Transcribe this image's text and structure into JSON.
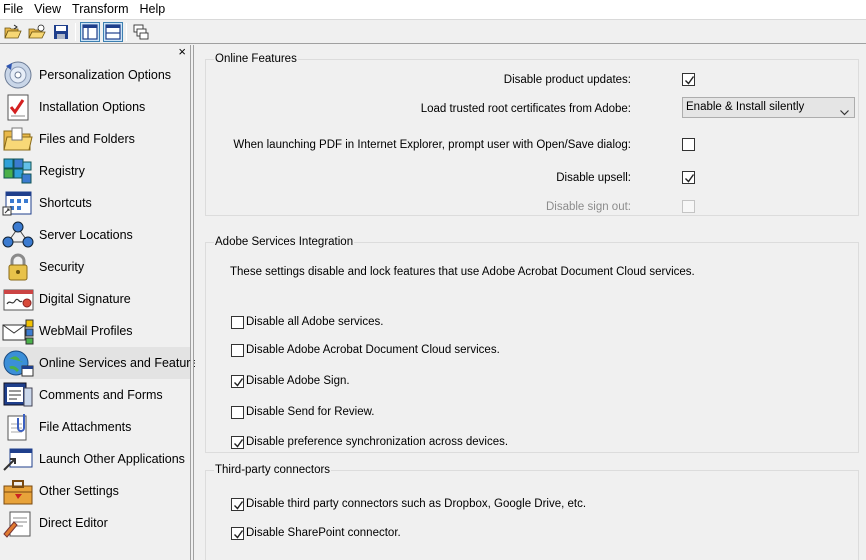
{
  "menu": [
    "File",
    "View",
    "Transform",
    "Help"
  ],
  "sidebar": {
    "close_glyph": "×",
    "items": [
      {
        "label": "Personalization Options",
        "icon": "cd-disc-icon"
      },
      {
        "label": "Installation Options",
        "icon": "checklist-icon"
      },
      {
        "label": "Files and Folders",
        "icon": "folder-icon"
      },
      {
        "label": "Registry",
        "icon": "registry-cubes-icon"
      },
      {
        "label": "Shortcuts",
        "icon": "shortcut-grid-icon"
      },
      {
        "label": "Server Locations",
        "icon": "network-icon"
      },
      {
        "label": "Security",
        "icon": "padlock-icon"
      },
      {
        "label": "Digital Signature",
        "icon": "signature-certificate-icon"
      },
      {
        "label": "WebMail Profiles",
        "icon": "envelope-icon"
      },
      {
        "label": "Online Services and Features",
        "icon": "globe-icon"
      },
      {
        "label": "Comments and Forms",
        "icon": "forms-icon"
      },
      {
        "label": "File Attachments",
        "icon": "paperclip-document-icon"
      },
      {
        "label": "Launch Other Applications",
        "icon": "launch-window-icon"
      },
      {
        "label": "Other Settings",
        "icon": "toolbox-icon"
      },
      {
        "label": "Direct Editor",
        "icon": "editor-icon"
      }
    ],
    "selected_index": 9
  },
  "online_features": {
    "title": "Online Features",
    "rows": [
      {
        "label": "Disable product updates:",
        "checked": true,
        "disabled": false
      },
      {
        "label": "Load trusted root certificates from Adobe:",
        "select_value": "Enable & Install silently"
      },
      {
        "label": "When launching PDF in Internet Explorer, prompt user with Open/Save dialog:",
        "checked": false,
        "disabled": false
      },
      {
        "label": "Disable upsell:",
        "checked": true,
        "disabled": false
      },
      {
        "label": "Disable sign out:",
        "checked": false,
        "disabled": true
      }
    ]
  },
  "adobe_services": {
    "title": "Adobe Services Integration",
    "description": "These settings disable and lock features that use Adobe Acrobat Document Cloud services.",
    "options": [
      {
        "label": "Disable all Adobe services.",
        "checked": false
      },
      {
        "label": "Disable Adobe Acrobat Document Cloud services.",
        "checked": false
      },
      {
        "label": "Disable Adobe Sign.",
        "checked": true
      },
      {
        "label": "Disable Send for Review.",
        "checked": false
      },
      {
        "label": "Disable preference synchronization across devices.",
        "checked": true
      }
    ]
  },
  "third_party": {
    "title": "Third-party connectors",
    "options": [
      {
        "label": "Disable third party connectors such as Dropbox, Google Drive, etc.",
        "checked": true
      },
      {
        "label": "Disable SharePoint connector.",
        "checked": true
      }
    ]
  }
}
